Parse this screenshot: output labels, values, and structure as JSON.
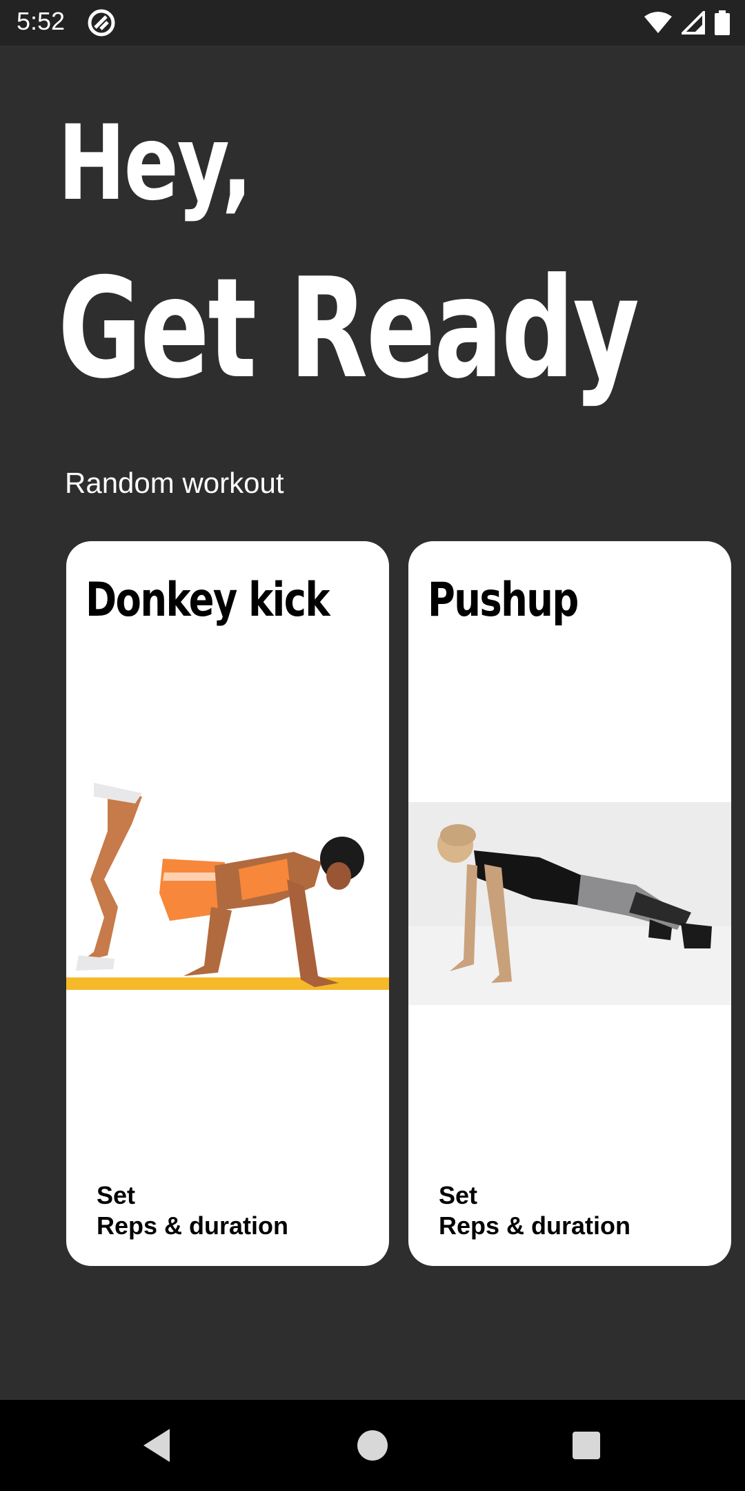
{
  "status": {
    "time": "5:52"
  },
  "headline": {
    "line1": "Hey,",
    "line2": "Get Ready"
  },
  "section": {
    "label": "Random workout"
  },
  "cards": [
    {
      "title": "Donkey kick",
      "set_label": "Set",
      "reps_label": "Reps & duration"
    },
    {
      "title": "Pushup",
      "set_label": "Set",
      "reps_label": "Reps & duration"
    }
  ],
  "colors": {
    "background": "#2e2e2f",
    "card": "#ffffff",
    "accent_orange": "#f7873a",
    "mat_yellow": "#f5b92a"
  },
  "icons": [
    "app-icon",
    "wifi-icon",
    "signal-icon",
    "battery-icon",
    "back-icon",
    "home-icon",
    "recents-icon"
  ]
}
